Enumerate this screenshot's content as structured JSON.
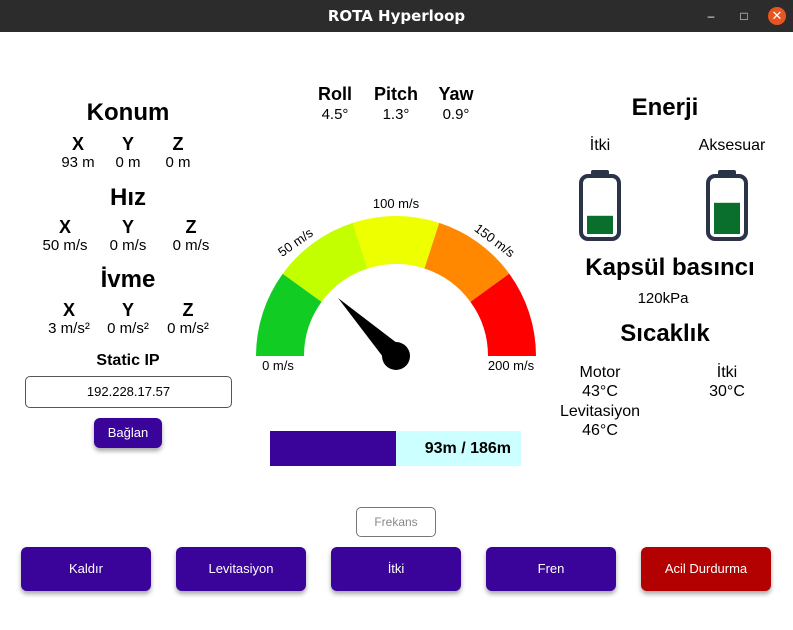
{
  "window": {
    "title": "ROTA Hyperloop"
  },
  "position": {
    "title": "Konum",
    "axes": [
      {
        "label": "X",
        "value": "93 m"
      },
      {
        "label": "Y",
        "value": "0 m"
      },
      {
        "label": "Z",
        "value": "0 m"
      }
    ]
  },
  "speed": {
    "title": "Hız",
    "axes": [
      {
        "label": "X",
        "value": "50 m/s"
      },
      {
        "label": "Y",
        "value": "0 m/s"
      },
      {
        "label": "Z",
        "value": "0 m/s"
      }
    ]
  },
  "accel": {
    "title": "İvme",
    "axes": [
      {
        "label": "X",
        "value": "3 m/s²"
      },
      {
        "label": "Y",
        "value": "0 m/s²"
      },
      {
        "label": "Z",
        "value": "0 m/s²"
      }
    ]
  },
  "network": {
    "title": "Static IP",
    "ip": "192.228.17.57",
    "connect_label": "Bağlan"
  },
  "orientation": [
    {
      "label": "Roll",
      "value": "4.5°"
    },
    {
      "label": "Pitch",
      "value": "1.3°"
    },
    {
      "label": "Yaw",
      "value": "0.9°"
    }
  ],
  "gauge": {
    "labels": [
      "0 m/s",
      "50 m/s",
      "100 m/s",
      "150 m/s",
      "200 m/s"
    ],
    "min": 0,
    "max": 200,
    "value": 50,
    "zone_colors": [
      "#11cc22",
      "#c4ff00",
      "#eeff00",
      "#ff8800",
      "#ff0000"
    ]
  },
  "progress": {
    "fraction": 0.5,
    "text": "93m / 186m",
    "fill_color": "#3a0399",
    "track_color": "#ccffff"
  },
  "energy": {
    "title": "Enerji",
    "batteries": [
      {
        "label": "İtki",
        "level": 0.35
      },
      {
        "label": "Aksesuar",
        "level": 0.6
      }
    ]
  },
  "pressure": {
    "title": "Kapsül basıncı",
    "value": "120kPa"
  },
  "temperature": {
    "title": "Sıcaklık",
    "items": [
      {
        "label": "Motor",
        "value": "43°C"
      },
      {
        "label": "İtki",
        "value": "30°C"
      },
      {
        "label": "Levitasiyon",
        "value": "46°C"
      }
    ]
  },
  "frequency": {
    "placeholder": "Frekans"
  },
  "actions": [
    {
      "label": "Kaldır"
    },
    {
      "label": "Levitasiyon"
    },
    {
      "label": "İtki"
    },
    {
      "label": "Fren"
    },
    {
      "label": "Acil Durdurma",
      "color": "#b30000"
    }
  ],
  "colors": {
    "accent": "#3a0399",
    "titlebar": "#2c2c2c",
    "battery_fill": "#0a6e2c",
    "battery_outline": "#2b3446"
  }
}
